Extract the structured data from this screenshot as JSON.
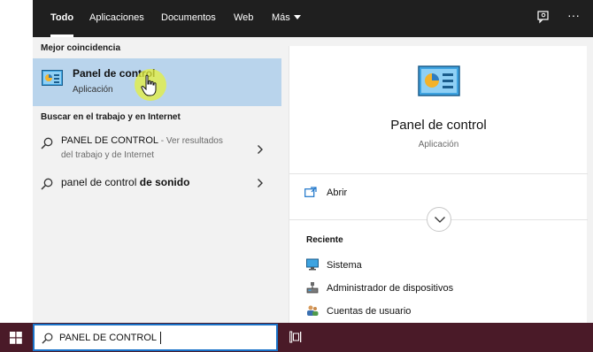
{
  "tabs": [
    {
      "label": "Todo",
      "active": true
    },
    {
      "label": "Aplicaciones",
      "active": false
    },
    {
      "label": "Documentos",
      "active": false
    },
    {
      "label": "Web",
      "active": false
    },
    {
      "label": "Más",
      "active": false
    }
  ],
  "top_icons": {
    "feedback": "feedback-icon",
    "more": "···"
  },
  "left": {
    "best_header": "Mejor coincidencia",
    "best_title": "Panel de control",
    "best_sub": "Aplicación",
    "web_header": "Buscar en el trabajo y en Internet",
    "results": [
      {
        "main": "PANEL DE CONTROL",
        "suffix": " - Ver resultados",
        "line2": "del trabajo y de Internet"
      },
      {
        "main": "panel de control ",
        "bold": "de sonido",
        "line2": ""
      }
    ]
  },
  "right": {
    "title": "Panel de control",
    "subtitle": "Aplicación",
    "open_label": "Abrir",
    "recent_header": "Reciente",
    "recent": [
      {
        "label": "Sistema",
        "icon": "monitor-icon"
      },
      {
        "label": "Administrador de dispositivos",
        "icon": "device-manager-icon"
      },
      {
        "label": "Cuentas de usuario",
        "icon": "users-icon"
      }
    ]
  },
  "taskbar": {
    "search_value": "PANEL DE CONTROL"
  },
  "colors": {
    "accent": "#1a73c9",
    "selected": "#b9d4ec",
    "taskbar": "#4a1a28",
    "topbar": "#1f1f1f"
  }
}
